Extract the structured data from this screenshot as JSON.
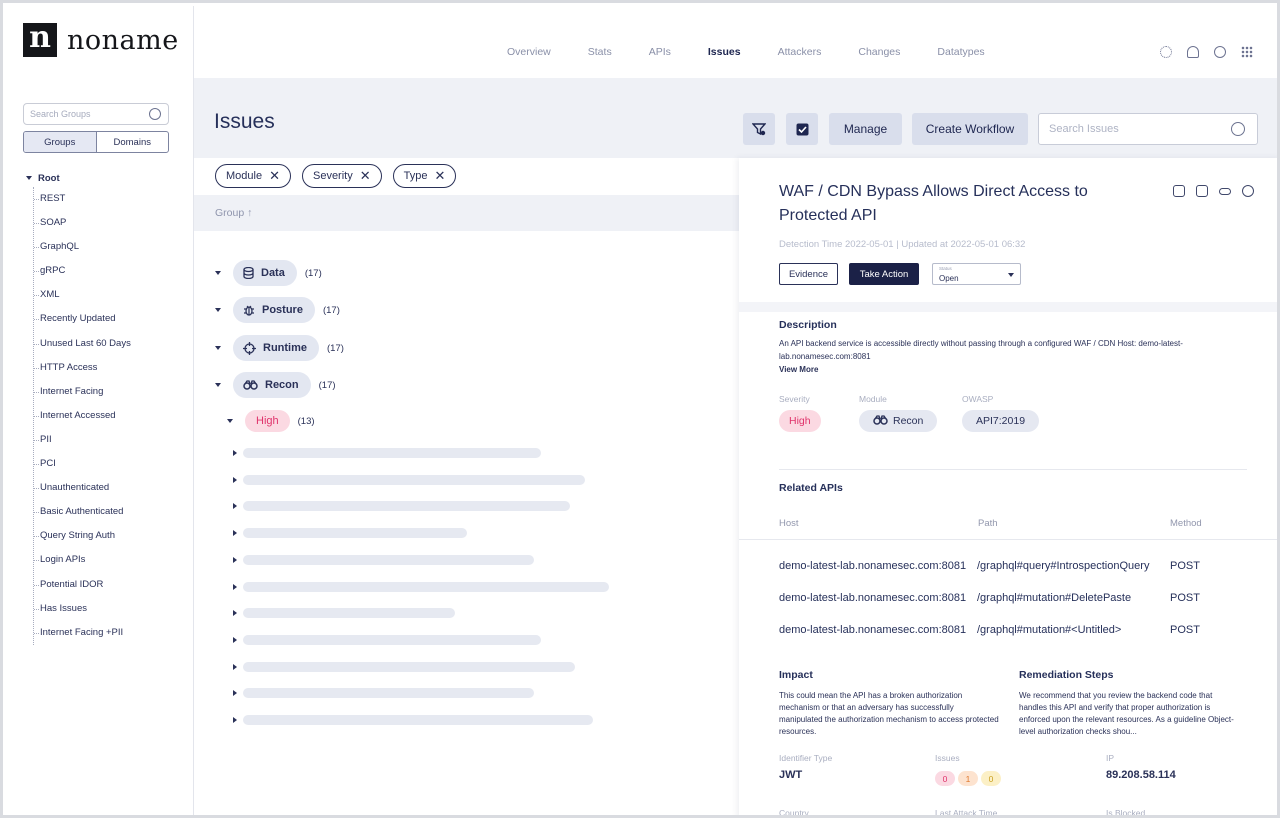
{
  "brand": {
    "logo_letter": "n",
    "name": "noname"
  },
  "sidebar": {
    "search_placeholder": "Search Groups",
    "toggle": {
      "groups": "Groups",
      "domains": "Domains"
    },
    "root_label": "Root",
    "items": [
      "REST",
      "SOAP",
      "GraphQL",
      "gRPC",
      "XML",
      "Recently Updated",
      "Unused Last 60 Days",
      "HTTP Access",
      "Internet Facing",
      "Internet Accessed",
      "PII",
      "PCI",
      "Unauthenticated",
      "Basic Authenticated",
      "Query String Auth",
      "Login APIs",
      "Potential IDOR",
      "Has Issues",
      "Internet Facing +PII"
    ]
  },
  "nav": {
    "links": [
      "Overview",
      "Stats",
      "APIs",
      "Issues",
      "Attackers",
      "Changes",
      "Datatypes"
    ],
    "active": "Issues",
    "icons": [
      "gear-icon",
      "bell-icon",
      "user-icon",
      "grid-icon"
    ]
  },
  "header": {
    "title": "Issues",
    "manage_label": "Manage",
    "create_workflow_label": "Create Workflow",
    "search_placeholder": "Search Issues"
  },
  "filters": {
    "chips": [
      "Module",
      "Severity",
      "Type"
    ],
    "group_label": "Group ↑"
  },
  "categories": [
    {
      "label": "Data",
      "count": "(17)",
      "icon": "database-icon"
    },
    {
      "label": "Posture",
      "count": "(17)",
      "icon": "bug-icon"
    },
    {
      "label": "Runtime",
      "count": "(17)",
      "icon": "crosshair-icon"
    },
    {
      "label": "Recon",
      "count": "(17)",
      "icon": "binoculars-icon"
    }
  ],
  "subgroup": {
    "label": "High",
    "count": "(13)"
  },
  "panel": {
    "title": "WAF / CDN Bypass Allows Direct Access to Protected API",
    "meta": "Detection Time 2022-05-01 | Updated at 2022-05-01 06:32",
    "evidence_label": "Evidence",
    "take_action_label": "Take Action",
    "status_label": "Status",
    "status_value": "Open",
    "description_heading": "Description",
    "description": "An API backend service is accessible directly without passing through a configured WAF / CDN Host: demo-latest-lab.nonamesec.com:8081",
    "view_more": "View More",
    "severity_label": "Severity",
    "severity_value": "High",
    "module_label": "Module",
    "module_value": "Recon",
    "owasp_label": "OWASP",
    "owasp_value": "API7:2019",
    "related_heading": "Related APIs",
    "related_columns": {
      "host": "Host",
      "path": "Path",
      "method": "Method"
    },
    "related_apis": [
      {
        "host": "demo-latest-lab.nonamesec.com:8081",
        "path": "/graphql#query#IntrospectionQuery",
        "method": "POST"
      },
      {
        "host": "demo-latest-lab.nonamesec.com:8081",
        "path": "/graphql#mutation#DeletePaste",
        "method": "POST"
      },
      {
        "host": "demo-latest-lab.nonamesec.com:8081",
        "path": "/graphql#mutation#<Untitled>",
        "method": "POST"
      }
    ],
    "impact_heading": "Impact",
    "impact_text": "This could mean the API has a broken authorization mechanism or that an adversary has successfully manipulated the authorization mechanism to access protected resources.",
    "remediation_heading": "Remediation Steps",
    "remediation_text": "We recommend that you review the backend code that handles this API and verify that proper authorization is enforced upon the relevant resources. As a guideline Object-level authorization checks shou...",
    "identifier_type_label": "Identifier Type",
    "identifier_type_value": "JWT",
    "issues_label": "Issues",
    "issue_counts": [
      "0",
      "1",
      "0"
    ],
    "ip_label": "IP",
    "ip_value": "89.208.58.114",
    "country_label": "Country",
    "last_attack_label": "Last Attack Time",
    "is_blocked_label": "Is Blocked"
  },
  "colors": {
    "accent": "#1b2147",
    "high": "#e0336b",
    "pill": "#e3e7f1",
    "band": "#eff1f6"
  }
}
